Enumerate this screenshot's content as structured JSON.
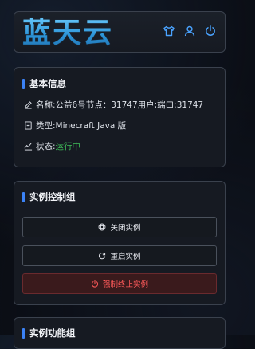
{
  "header": {
    "logo_text": "蓝天云",
    "icons": [
      "shirt-icon",
      "user-icon",
      "power-icon"
    ]
  },
  "basic_info": {
    "title": "基本信息",
    "name_label": "名称: ",
    "name_value": "公益6号节点：31747用户;端口:31747",
    "type_label": "类型: ",
    "type_value": "Minecraft Java 版",
    "status_label": "状态: ",
    "status_value": "运行中"
  },
  "control_group": {
    "title": "实例控制组",
    "close_label": "关闭实例",
    "restart_label": "重启实例",
    "force_stop_label": "强制终止实例"
  },
  "function_group": {
    "title": "实例功能组"
  },
  "colors": {
    "accent": "#3b82f6",
    "status_running": "#3fbf5a",
    "danger": "#ff5a5a"
  }
}
